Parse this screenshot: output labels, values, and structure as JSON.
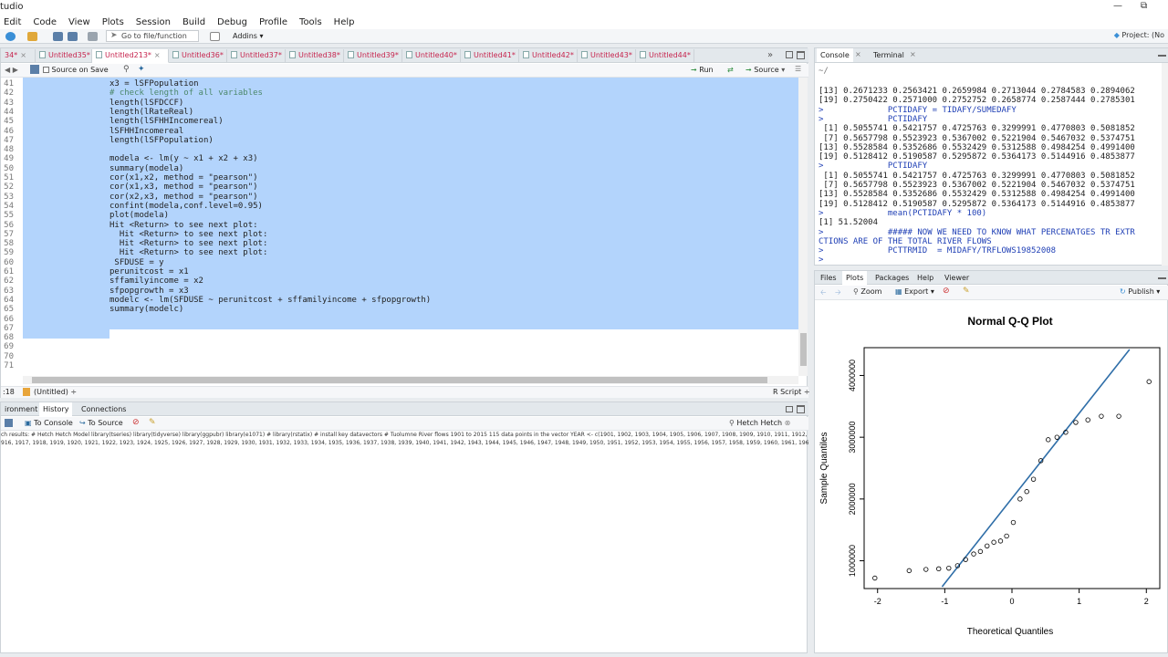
{
  "window": {
    "title": "tudio",
    "minimize": "—",
    "restore": "⧉"
  },
  "menu": [
    "Edit",
    "Code",
    "View",
    "Plots",
    "Session",
    "Build",
    "Debug",
    "Profile",
    "Tools",
    "Help"
  ],
  "toolbar": {
    "goto_placeholder": "Go to file/function",
    "addins": "Addins ▾",
    "project": "Project: (No"
  },
  "editor": {
    "tabs": [
      {
        "label": "34*",
        "active": false
      },
      {
        "label": "Untitled35*",
        "active": false
      },
      {
        "label": "Untitled213*",
        "active": true
      },
      {
        "label": "Untitled36*",
        "active": false
      },
      {
        "label": "Untitled37*",
        "active": false
      },
      {
        "label": "Untitled38*",
        "active": false
      },
      {
        "label": "Untitled39*",
        "active": false
      },
      {
        "label": "Untitled40*",
        "active": false
      },
      {
        "label": "Untitled41*",
        "active": false
      },
      {
        "label": "Untitled42*",
        "active": false
      },
      {
        "label": "Untitled43*",
        "active": false
      },
      {
        "label": "Untitled44*",
        "active": false
      }
    ],
    "source_on_save": "Source on Save",
    "run": "Run",
    "source": "Source",
    "lines": [
      {
        "n": "41",
        "text": "x3 = lSFPopulation"
      },
      {
        "n": "42",
        "text": "# check length of all variables",
        "comment": true
      },
      {
        "n": "43",
        "text": "length(lSFDCCF)"
      },
      {
        "n": "44",
        "text": "length(lRateReal)"
      },
      {
        "n": "45",
        "text": "length(lSFHHIncomereal)"
      },
      {
        "n": "46",
        "text": "lSFHHIncomereal"
      },
      {
        "n": "47",
        "text": "length(lSFPopulation)"
      },
      {
        "n": "48",
        "text": ""
      },
      {
        "n": "49",
        "text": "modela <- lm(y ~ x1 + x2 + x3)"
      },
      {
        "n": "50",
        "text": "summary(modela)"
      },
      {
        "n": "51",
        "text": "cor(x1,x2, method = \"pearson\")"
      },
      {
        "n": "52",
        "text": "cor(x1,x3, method = \"pearson\")"
      },
      {
        "n": "53",
        "text": "cor(x2,x3, method = \"pearson\")"
      },
      {
        "n": "54",
        "text": "confint(modela,conf.level=0.95)"
      },
      {
        "n": "55",
        "text": "plot(modela)"
      },
      {
        "n": "56",
        "text": "Hit <Return> to see next plot:"
      },
      {
        "n": "57",
        "text": "  Hit <Return> to see next plot:"
      },
      {
        "n": "58",
        "text": "  Hit <Return> to see next plot:"
      },
      {
        "n": "59",
        "text": "  Hit <Return> to see next plot:"
      },
      {
        "n": "60",
        "text": " SFDUSE = y"
      },
      {
        "n": "61",
        "text": "perunitcost = x1"
      },
      {
        "n": "62",
        "text": "sffamilyincome = x2"
      },
      {
        "n": "63",
        "text": "sfpopgrowth = x3"
      },
      {
        "n": "64",
        "text": "modelc <- lm(SFDUSE ~ perunitcost + sffamilyincome + sfpopgrowth)"
      },
      {
        "n": "65",
        "text": "summary(modelc)"
      },
      {
        "n": "66",
        "text": ""
      },
      {
        "n": "67",
        "text": ""
      },
      {
        "n": "68",
        "text": ""
      },
      {
        "n": "69",
        "text": ""
      },
      {
        "n": "70",
        "text": ""
      },
      {
        "n": "71",
        "text": ""
      }
    ],
    "status_pos": ":18",
    "status_scope": "(Untitled) ÷",
    "status_lang": "R Script ÷"
  },
  "history": {
    "tabs": [
      "ironment",
      "History",
      "Connections"
    ],
    "to_console": "To Console",
    "to_source": "To Source",
    "search": "Hetch Hetch",
    "line1": "ch results: # Hetch Hetch Model library(tseries) library(tidyverse) library(ggpubr) library(e1071) # library(rstatix) # install key datavectors # Tuolumne River flows 1901 to 2015 115 data points in the vector YEAR <- c(1901, 1902, 1903, 1904, 1905, 1906, 1907, 1908, 1909, 1910, 1911, 1912, 1913,",
    "line2": "916, 1917, 1918, 1919, 1920, 1921, 1922, 1923, 1924, 1925, 1926, 1927, 1928, 1929, 1930, 1931, 1932, 1933, 1934, 1935, 1936, 1937, 1938, 1939, 1940, 1941, 1942, 1943, 1944, 1945, 1946, 1947, 1948, 1949, 1950, 1951, 1952, 1953, 1954, 1955, 1956, 1957, 1958, 1959, 1960, 1961, 1962, 1963, 1964"
  },
  "console": {
    "tabs": [
      "Console",
      "Terminal"
    ],
    "path": "~/",
    "lines": [
      {
        "t": "[13] 0.2671233 0.2563421 0.2659984 0.2713044 0.2784583 0.2894062"
      },
      {
        "t": "[19] 0.2750422 0.2571000 0.2752752 0.2658774 0.2587444 0.2785301"
      },
      {
        "t": ">             PCTIDAFY = TIDAFY/SUMEDAFY",
        "cmd": true
      },
      {
        "t": ">             PCTIDAFY",
        "cmd": true
      },
      {
        "t": " [1] 0.5055741 0.5421757 0.4725763 0.3299991 0.4770803 0.5081852"
      },
      {
        "t": " [7] 0.5657798 0.5523923 0.5367002 0.5221904 0.5467032 0.5374751"
      },
      {
        "t": "[13] 0.5528584 0.5352686 0.5532429 0.5312588 0.4984254 0.4991400"
      },
      {
        "t": "[19] 0.5128412 0.5190587 0.5295872 0.5364173 0.5144916 0.4853877"
      },
      {
        "t": ">             PCTIDAFY",
        "cmd": true
      },
      {
        "t": " [1] 0.5055741 0.5421757 0.4725763 0.3299991 0.4770803 0.5081852"
      },
      {
        "t": " [7] 0.5657798 0.5523923 0.5367002 0.5221904 0.5467032 0.5374751"
      },
      {
        "t": "[13] 0.5528584 0.5352686 0.5532429 0.5312588 0.4984254 0.4991400"
      },
      {
        "t": "[19] 0.5128412 0.5190587 0.5295872 0.5364173 0.5144916 0.4853877"
      },
      {
        "t": ">             mean(PCTIDAFY * 100)",
        "cmd": true
      },
      {
        "t": "[1] 51.52004"
      },
      {
        "t": ">             ##### NOW WE NEED TO KNOW WHAT PERCENATGES TR EXTR",
        "cmd": true
      },
      {
        "t": "CTIONS ARE OF THE TOTAL RIVER FLOWS",
        "cmd": true
      },
      {
        "t": ">             PCTTRMID  = MIDAFY/TRFLOWS19852008",
        "cmd": true
      },
      {
        "t": ">",
        "cmd": true
      }
    ]
  },
  "plots": {
    "tabs": [
      "Files",
      "Plots",
      "Packages",
      "Help",
      "Viewer"
    ],
    "zoom": "Zoom",
    "export": "Export ▾",
    "publish": "Publish ▾"
  },
  "chart_data": {
    "type": "scatter",
    "title": "Normal Q-Q Plot",
    "xlabel": "Theoretical Quantiles",
    "ylabel": "Sample Quantiles",
    "xlim": [
      -2.2,
      2.2
    ],
    "ylim": [
      550000,
      4450000
    ],
    "xticks": [
      -2,
      -1,
      0,
      1,
      2
    ],
    "yticks": [
      1000000,
      2000000,
      3000000,
      4000000
    ],
    "points": {
      "x": [
        -2.04,
        -1.53,
        -1.28,
        -1.09,
        -0.94,
        -0.81,
        -0.69,
        -0.57,
        -0.47,
        -0.37,
        -0.27,
        -0.17,
        -0.08,
        0.02,
        0.12,
        0.22,
        0.32,
        0.43,
        0.54,
        0.67,
        0.8,
        0.95,
        1.13,
        1.33,
        1.59,
        2.04
      ],
      "y": [
        720000,
        840000,
        860000,
        870000,
        880000,
        920000,
        1020000,
        1110000,
        1150000,
        1240000,
        1300000,
        1320000,
        1400000,
        1620000,
        2000000,
        2120000,
        2320000,
        2620000,
        2960000,
        3000000,
        3080000,
        3240000,
        3280000,
        3340000,
        3340000,
        3900000
      ]
    },
    "line": {
      "x": [
        -1.04,
        1.75
      ],
      "y": [
        580000,
        4420000
      ]
    },
    "color": "#2f6ea8"
  }
}
